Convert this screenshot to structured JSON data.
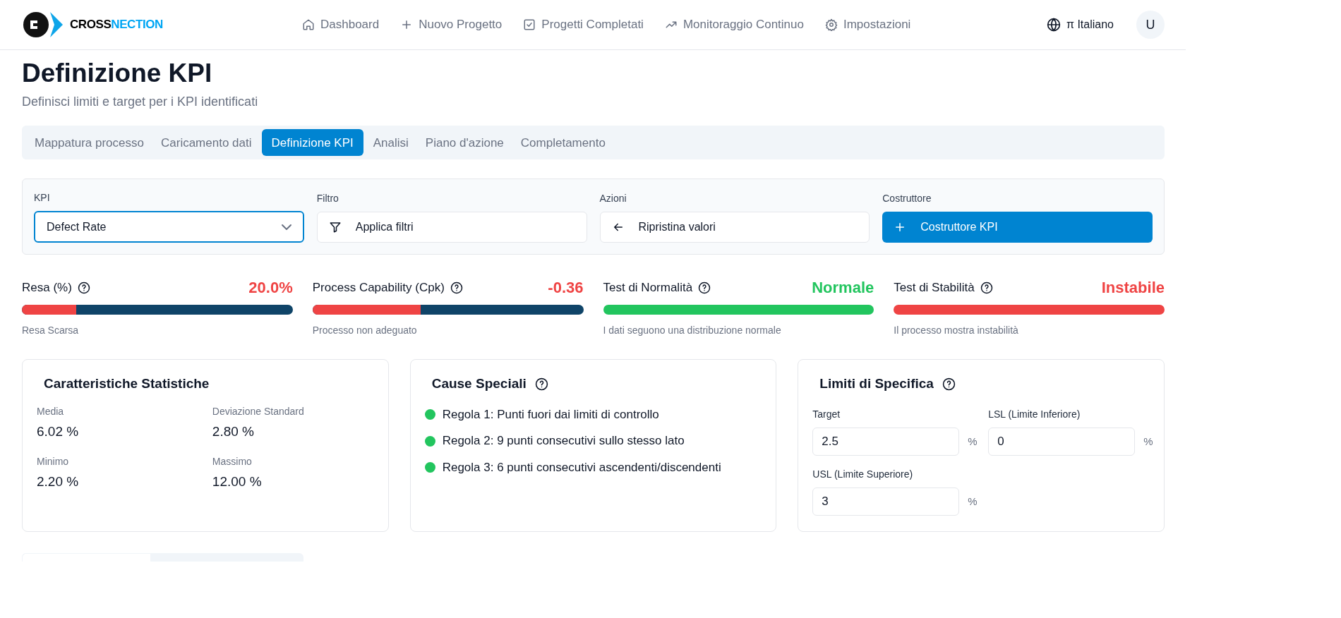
{
  "brand": {
    "part1": "CROSS",
    "part2": "NECTION"
  },
  "nav": [
    {
      "label": "Dashboard"
    },
    {
      "label": "Nuovo Progetto"
    },
    {
      "label": "Progetti Completati"
    },
    {
      "label": "Monitoraggio Continuo"
    },
    {
      "label": "Impostazioni"
    }
  ],
  "language": {
    "glyph": "π",
    "label": "Italiano"
  },
  "avatar": "U",
  "page": {
    "title": "Definizione KPI",
    "subtitle": "Definisci limiti e target per i KPI identificati"
  },
  "steps": [
    {
      "label": "Mappatura processo",
      "selected": false
    },
    {
      "label": "Caricamento dati",
      "selected": false
    },
    {
      "label": "Definizione KPI",
      "selected": true
    },
    {
      "label": "Analisi",
      "selected": false
    },
    {
      "label": "Piano d'azione",
      "selected": false
    },
    {
      "label": "Completamento",
      "selected": false
    }
  ],
  "toolbar": [
    {
      "kind": "select",
      "label": "KPI",
      "value": "Defect Rate"
    },
    {
      "kind": "filter",
      "label": "Filtro",
      "value": "Applica filtri"
    },
    {
      "kind": "reset",
      "label": "Azioni",
      "value": "Ripristina valori"
    },
    {
      "kind": "primary",
      "label": "Costruttore",
      "value": "Costruttore KPI"
    }
  ],
  "metrics": [
    {
      "title": "Resa (%)",
      "value": "20.0%",
      "level": 0.2,
      "color": "#ef4444",
      "note": "Resa Scarsa"
    },
    {
      "title": "Process Capability (Cpk)",
      "value": "-0.36",
      "level": 0.4,
      "color": "#ef4444",
      "note": "Processo non adeguato"
    },
    {
      "title": "Test di Normalità",
      "value": "Normale",
      "level": 1,
      "color": "#22c55e",
      "note": "I dati seguono una distribuzione normale"
    },
    {
      "title": "Test di Stabilità",
      "value": "Instabile",
      "level": 1,
      "color": "#ef4444",
      "note": "Il processo mostra instabilità"
    }
  ],
  "stats": {
    "title": "Caratteristiche Statistiche",
    "items": [
      {
        "label": "Media",
        "value": "6.02 %"
      },
      {
        "label": "Deviazione Standard",
        "value": "2.80 %"
      },
      {
        "label": "Minimo",
        "value": "2.20 %"
      },
      {
        "label": "Massimo",
        "value": "12.00 %"
      }
    ]
  },
  "causes": {
    "title": "Cause Speciali",
    "rules": [
      {
        "text": "Regola 1: Punti fuori dai limiti di controllo",
        "color": "#22c55e"
      },
      {
        "text": "Regola 2: 9 punti consecutivi sullo stesso lato",
        "color": "#22c55e"
      },
      {
        "text": "Regola 3: 6 punti consecutivi ascendenti/discendenti",
        "color": "#22c55e"
      }
    ]
  },
  "limits": {
    "title": "Limiti di Specifica",
    "fields": [
      {
        "label": "Target",
        "value": "2.5",
        "unit": "%"
      },
      {
        "label": "LSL (Limite Inferiore)",
        "value": "0",
        "unit": "%"
      },
      {
        "label": "USL (Limite Superiore)",
        "value": "3",
        "unit": "%"
      }
    ]
  }
}
